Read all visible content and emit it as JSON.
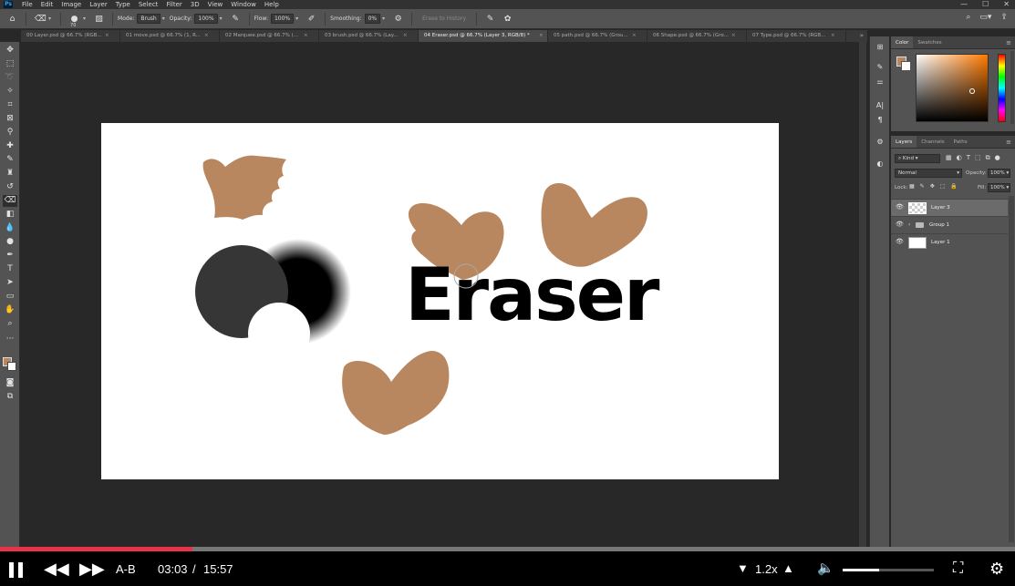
{
  "menubar": {
    "items": [
      "File",
      "Edit",
      "Image",
      "Layer",
      "Type",
      "Select",
      "Filter",
      "3D",
      "View",
      "Window",
      "Help"
    ],
    "logo": "Ps"
  },
  "options": {
    "brush_size": "70",
    "mode_label": "Mode:",
    "mode_value": "Brush",
    "opacity_label": "Opacity:",
    "opacity_value": "100%",
    "flow_label": "Flow:",
    "flow_value": "100%",
    "smoothing_label": "Smoothing:",
    "smoothing_value": "0%",
    "erase_to_history": "Erase to History"
  },
  "tabs": [
    {
      "label": "00 Layer.psd @ 66.7% (RGB...",
      "active": false
    },
    {
      "label": "01 move.psd @ 66.7% (1, R...",
      "active": false
    },
    {
      "label": "02 Marquee.psd @ 66.7% (...",
      "active": false
    },
    {
      "label": "03 brush.psd @ 66.7% (Lay...",
      "active": false
    },
    {
      "label": "04 Eraser.psd @ 66.7% (Layer 3, RGB/8) *",
      "active": true
    },
    {
      "label": "05 path.psd @ 66.7% (Grou...",
      "active": false
    },
    {
      "label": "06 Shape.psd @ 66.7% (Gro...",
      "active": false
    },
    {
      "label": "07 Type.psd @ 66.7% (RGB...",
      "active": false
    }
  ],
  "canvas": {
    "text": "Eraser",
    "shape_color": "#b8875f",
    "dark_circle_color": "#363636",
    "text_color": "#000000"
  },
  "color_panel": {
    "tabs": [
      "Color",
      "Swatches"
    ],
    "foreground": "#b8875f",
    "background": "#ffffff"
  },
  "layers_panel": {
    "tabs": [
      "Layers",
      "Channels",
      "Paths"
    ],
    "filter_kind": "Kind",
    "blend_mode": "Normal",
    "opacity_label": "Opacity:",
    "opacity_value": "100%",
    "lock_label": "Lock:",
    "fill_label": "Fill:",
    "fill_value": "100%",
    "layers": [
      {
        "name": "Layer 3",
        "selected": true,
        "type": "layer"
      },
      {
        "name": "Group 1",
        "selected": false,
        "type": "group"
      },
      {
        "name": "Layer 1",
        "selected": false,
        "type": "layer"
      }
    ]
  },
  "player": {
    "ab_label": "A-B",
    "current_time": "03:03",
    "separator": "/",
    "duration": "15:57",
    "speed": "1.2x",
    "progress": 0.19,
    "volume": 0.4,
    "accent_color": "#e8344a"
  }
}
